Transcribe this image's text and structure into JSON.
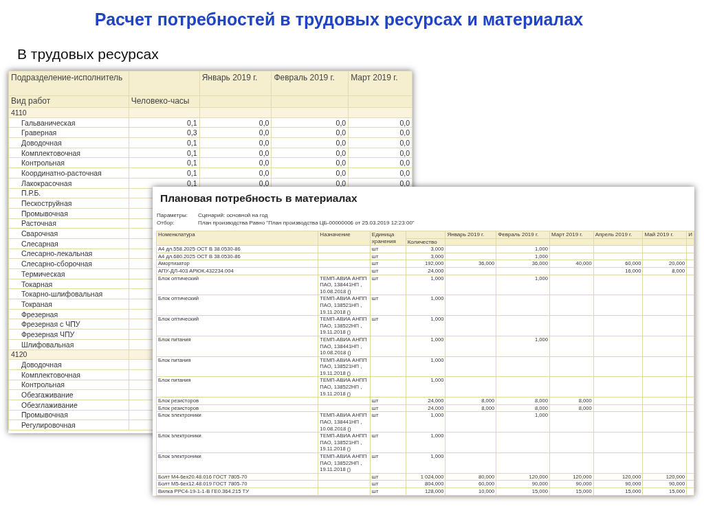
{
  "slide": {
    "title": "Расчет потребностей в трудовых ресурсах и материалах",
    "subtitle": "В трудовых ресурсах"
  },
  "labor_report": {
    "header": {
      "group_label": "Подразделение-исполнитель",
      "item_label": "Вид работ",
      "measure": "Человеко-часы",
      "months": [
        "Январь 2019 г.",
        "Февраль 2019 г.",
        "Март 2019 г."
      ]
    },
    "groups": [
      {
        "name": "4110",
        "rows": [
          {
            "name": "Гальваническая",
            "values": [
              "0,1",
              "0,0",
              "0,0",
              "0,0"
            ]
          },
          {
            "name": "Граверная",
            "values": [
              "0,3",
              "0,0",
              "0,0",
              "0,0"
            ]
          },
          {
            "name": "Доводочная",
            "values": [
              "0,1",
              "0,0",
              "0,0",
              "0,0"
            ]
          },
          {
            "name": "Комплектовочная",
            "values": [
              "0,1",
              "0,0",
              "0,0",
              "0,0"
            ]
          },
          {
            "name": "Контрольная",
            "values": [
              "0,1",
              "0,0",
              "0,0",
              "0,0"
            ]
          },
          {
            "name": "Координатно-расточная",
            "values": [
              "0,1",
              "0,0",
              "0,0",
              "0,0"
            ]
          },
          {
            "name": "Лакокрасочная",
            "values": [
              "0,1",
              "0,0",
              "0,0",
              "0,0"
            ]
          },
          {
            "name": "П.Р.Б."
          },
          {
            "name": "Пескоструйная"
          },
          {
            "name": "Промывочная"
          },
          {
            "name": "Расточная"
          },
          {
            "name": "Сварочная"
          },
          {
            "name": "Слесарная"
          },
          {
            "name": "Слесарно-лекальная"
          },
          {
            "name": "Слесарно-сборочная"
          },
          {
            "name": "Термическая"
          },
          {
            "name": "Токарная"
          },
          {
            "name": "Токарно-шлифовальная"
          },
          {
            "name": "Токраная"
          },
          {
            "name": "Фрезерная"
          },
          {
            "name": "Фрезерная с ЧПУ"
          },
          {
            "name": "Фрезерная ЧПУ"
          },
          {
            "name": "Шлифовальная"
          }
        ]
      },
      {
        "name": "4120",
        "rows": [
          {
            "name": "Доводочная"
          },
          {
            "name": "Комплектовочная"
          },
          {
            "name": "Контрольная"
          },
          {
            "name": "Обезгаживание"
          },
          {
            "name": "Обезглаживание"
          },
          {
            "name": "Промывочная"
          },
          {
            "name": "Регулировочная"
          }
        ]
      }
    ]
  },
  "materials_report": {
    "title": "Плановая потребность в материалах",
    "parameters": [
      {
        "label": "Параметры:",
        "value": "Сценарий: основной на год"
      },
      {
        "label": "Отбор:",
        "value": "План производства Равно \"План производства ЦБ-00000006 от 25.03.2019 12:23:00\""
      }
    ],
    "columns": {
      "item": "Номенклатура",
      "purpose": "Назначение",
      "unit": "Единица хранения",
      "quantity": "Количество",
      "months": [
        "Январь 2019 г.",
        "Февраль 2019 г.",
        "Март 2019 г.",
        "Апрель 2019 г.",
        "Май 2019 г.",
        "И"
      ]
    },
    "rows": [
      {
        "item": "А4 дл.558.2025 ОСТ В 38.0530-86",
        "unit": "шт",
        "quantity": "3,000",
        "february": "1,000"
      },
      {
        "item": "А4 дл.680.2025 ОСТ В 38.0530-86",
        "unit": "шт",
        "quantity": "3,000",
        "february": "1,000"
      },
      {
        "item": "Амортизатор",
        "unit": "шт",
        "quantity": "192,000",
        "january": "36,000",
        "february": "36,000",
        "march": "40,000",
        "april": "60,000",
        "may": "20,000"
      },
      {
        "item": "АПУ-ДЛ-403 АРЮК.432234.004",
        "unit": "шт",
        "quantity": "24,000",
        "april": "16,000",
        "may": "8,000"
      },
      {
        "item": "Блок оптический",
        "purpose": "ТЕМП-АВИА АНПП ПАО, 138441НП , 10.08.2018 ()",
        "unit": "шт",
        "quantity": "1,000",
        "february": "1,000"
      },
      {
        "item": "Блок оптический",
        "purpose": "ТЕМП-АВИА АНПП ПАО, 138521НП , 19.11.2018 ()",
        "unit": "шт",
        "quantity": "1,000"
      },
      {
        "item": "Блок оптический",
        "purpose": "ТЕМП-АВИА АНПП ПАО, 138522НП , 19.11.2018 ()",
        "unit": "шт",
        "quantity": "1,000"
      },
      {
        "item": "Блок питания",
        "purpose": "ТЕМП-АВИА АНПП ПАО, 138441НП , 10.08.2018 ()",
        "quantity": "1,000",
        "february": "1,000"
      },
      {
        "item": "Блок питания",
        "purpose": "ТЕМП-АВИА АНПП ПАО, 138521НП , 19.11.2018 ()",
        "quantity": "1,000"
      },
      {
        "item": "Блок питания",
        "purpose": "ТЕМП-АВИА АНПП ПАО, 138522НП , 19.11.2018 ()",
        "quantity": "1,000"
      },
      {
        "item": "Блок резисторов",
        "unit": "шт",
        "quantity": "24,000",
        "january": "8,000",
        "february": "8,000",
        "march": "8,000"
      },
      {
        "item": "Блок резисторов",
        "unit": "шт",
        "quantity": "24,000",
        "january": "8,000",
        "february": "8,000",
        "march": "8,000"
      },
      {
        "item": "Блок электроники",
        "purpose": "ТЕМП-АВИА АНПП ПАО, 138441НП , 10.08.2018 ()",
        "unit": "шт",
        "quantity": "1,000",
        "february": "1,000"
      },
      {
        "item": "Блок электроники",
        "purpose": "ТЕМП-АВИА АНПП ПАО, 138521НП , 19.11.2018 ()",
        "unit": "шт",
        "quantity": "1,000"
      },
      {
        "item": "Блок электроники",
        "purpose": "ТЕМП-АВИА АНПП ПАО, 138522НП , 19.11.2018 ()",
        "unit": "шт",
        "quantity": "1,000"
      },
      {
        "item": "Болт М4-6ех20.48.016 ГОСТ 7805-70",
        "unit": "шт",
        "quantity": "1 024,000",
        "january": "80,000",
        "february": "120,000",
        "march": "120,000",
        "april": "120,000",
        "may": "120,000"
      },
      {
        "item": "Болт М5-6ех12.48.019 ГОСТ 7805-70",
        "unit": "шт",
        "quantity": "804,000",
        "january": "60,000",
        "february": "90,000",
        "march": "90,000",
        "april": "90,000",
        "may": "90,000"
      },
      {
        "item": "Вилка РРС4-19-1-1-В ГЕ0.364.215 ТУ",
        "unit": "шт",
        "quantity": "128,000",
        "january": "10,000",
        "february": "15,000",
        "march": "15,000",
        "april": "15,000",
        "may": "15,000"
      }
    ]
  }
}
